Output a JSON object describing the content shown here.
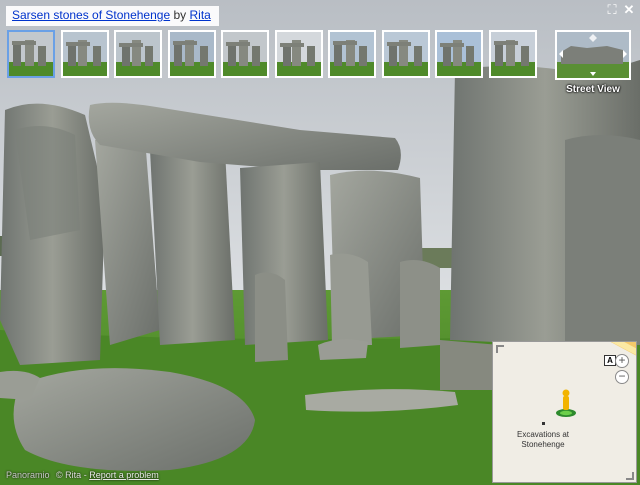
{
  "title": {
    "photo_title": "Sarsen stones of Stonehenge",
    "by_word": "by",
    "author": "Rita"
  },
  "controls": {
    "fullscreen_glyph": "⛶",
    "close_glyph": "✕"
  },
  "thumbnails": {
    "count": 10,
    "selected_index": 0
  },
  "street_view": {
    "label": "Street View"
  },
  "mini_map": {
    "road_badge": "A",
    "zoom_in": "+",
    "zoom_out": "−",
    "place_label": "Excavations at Stonehenge"
  },
  "footer": {
    "brand": "Panoramio",
    "copyright": "© Rita",
    "separator": "-",
    "report_link": "Report a problem"
  },
  "colors": {
    "link": "#0033cc",
    "selected_thumb_border": "#6aa0e6",
    "grass": "#4f8a2a",
    "sky": "#c9cdd2",
    "stone": "#8e918a"
  }
}
